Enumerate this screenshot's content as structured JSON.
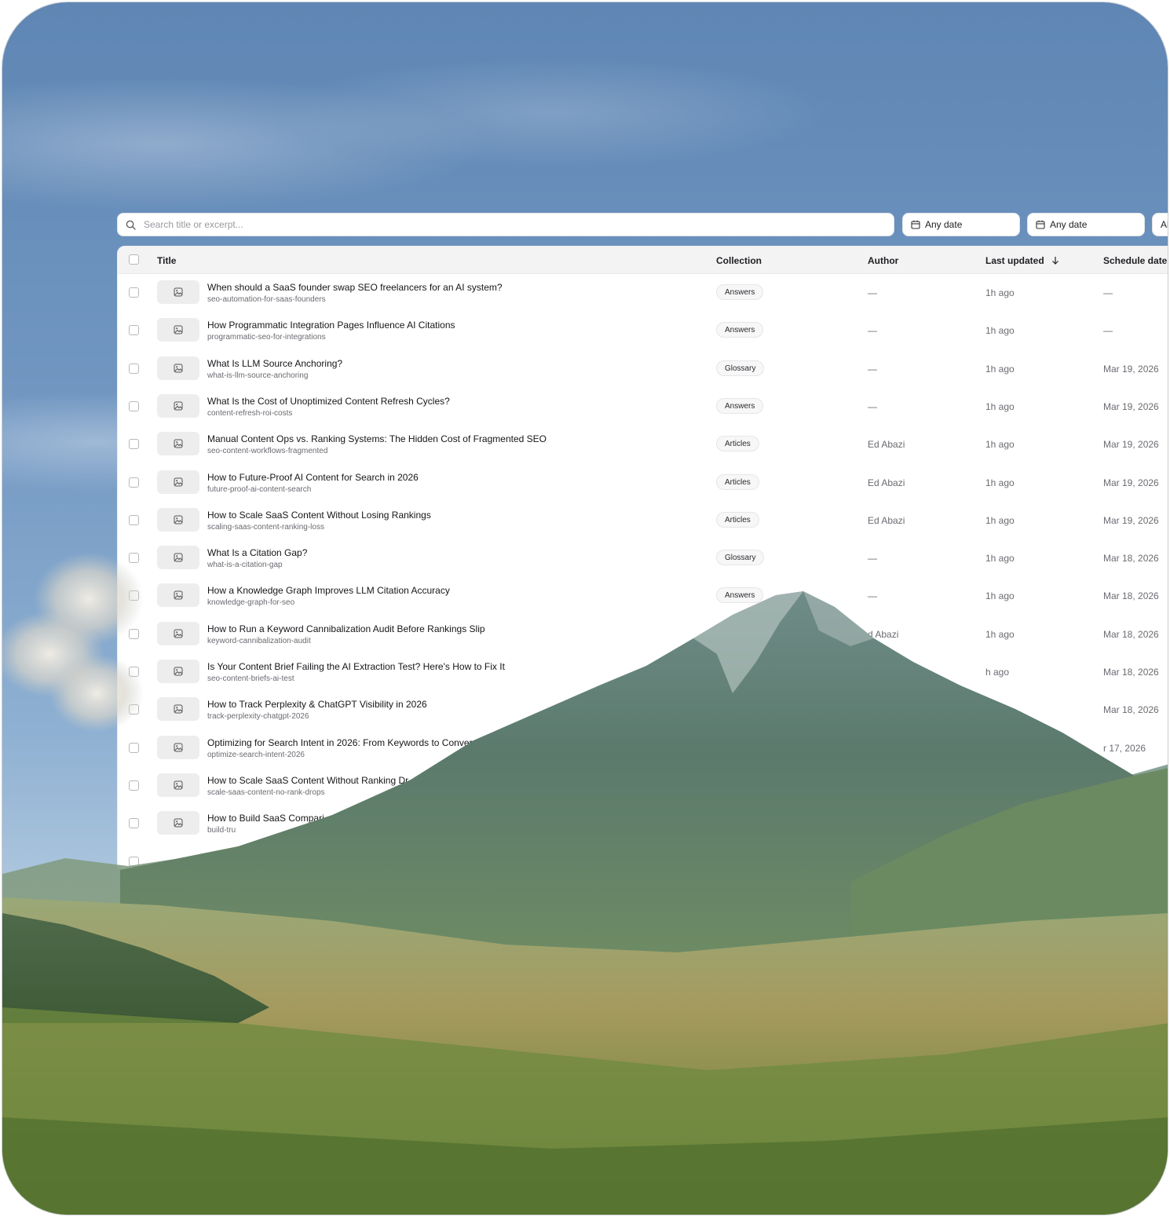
{
  "search": {
    "placeholder": "Search title or excerpt..."
  },
  "filters": {
    "date_from_label": "Any date",
    "date_to_label": "Any date",
    "third_label": "Al"
  },
  "table": {
    "columns": {
      "title": "Title",
      "collection": "Collection",
      "author": "Author",
      "last_updated": "Last updated",
      "schedule_date": "Schedule date"
    },
    "rows": [
      {
        "title": "When should a SaaS founder swap SEO freelancers for an AI system?",
        "slug": "seo-automation-for-saas-founders",
        "collection": "Answers",
        "author": "—",
        "updated": "1h ago",
        "schedule": "—"
      },
      {
        "title": "How Programmatic Integration Pages Influence AI Citations",
        "slug": "programmatic-seo-for-integrations",
        "collection": "Answers",
        "author": "—",
        "updated": "1h ago",
        "schedule": "—"
      },
      {
        "title": "What Is LLM Source Anchoring?",
        "slug": "what-is-llm-source-anchoring",
        "collection": "Glossary",
        "author": "—",
        "updated": "1h ago",
        "schedule": "Mar 19, 2026"
      },
      {
        "title": "What Is the Cost of Unoptimized Content Refresh Cycles?",
        "slug": "content-refresh-roi-costs",
        "collection": "Answers",
        "author": "—",
        "updated": "1h ago",
        "schedule": "Mar 19, 2026"
      },
      {
        "title": "Manual Content Ops vs. Ranking Systems: The Hidden Cost of Fragmented SEO",
        "slug": "seo-content-workflows-fragmented",
        "collection": "Articles",
        "author": "Ed Abazi",
        "updated": "1h ago",
        "schedule": "Mar 19, 2026"
      },
      {
        "title": "How to Future-Proof AI Content for Search in 2026",
        "slug": "future-proof-ai-content-search",
        "collection": "Articles",
        "author": "Ed Abazi",
        "updated": "1h ago",
        "schedule": "Mar 19, 2026"
      },
      {
        "title": "How to Scale SaaS Content Without Losing Rankings",
        "slug": "scaling-saas-content-ranking-loss",
        "collection": "Articles",
        "author": "Ed Abazi",
        "updated": "1h ago",
        "schedule": "Mar 19, 2026"
      },
      {
        "title": "What Is a Citation Gap?",
        "slug": "what-is-a-citation-gap",
        "collection": "Glossary",
        "author": "—",
        "updated": "1h ago",
        "schedule": "Mar 18, 2026"
      },
      {
        "title": "How a Knowledge Graph Improves LLM Citation Accuracy",
        "slug": "knowledge-graph-for-seo",
        "collection": "Answers",
        "author": "—",
        "updated": "1h ago",
        "schedule": "Mar 18, 2026"
      },
      {
        "title": "How to Run a Keyword Cannibalization Audit Before Rankings Slip",
        "slug": "keyword-cannibalization-audit",
        "collection": "",
        "author": "d Abazi",
        "updated": "1h ago",
        "schedule": "Mar 18, 2026"
      },
      {
        "title": "Is Your Content Brief Failing the AI Extraction Test? Here's How to Fix It",
        "slug": "seo-content-briefs-ai-test",
        "collection": "",
        "author": "",
        "updated": "h ago",
        "schedule": "Mar 18, 2026"
      },
      {
        "title": "How to Track Perplexity & ChatGPT Visibility in 2026",
        "slug": "track-perplexity-chatgpt-2026",
        "collection": "",
        "author": "",
        "updated": "",
        "schedule": "Mar 18, 2026"
      },
      {
        "title": "Optimizing for Search Intent in 2026: From Keywords to Conver",
        "slug": "optimize-search-intent-2026",
        "collection": "",
        "author": "",
        "updated": "",
        "schedule": "r 17, 2026"
      },
      {
        "title": "How to Scale SaaS Content Without Ranking Dr",
        "slug": "scale-saas-content-no-rank-drops",
        "collection": "",
        "author": "",
        "updated": "",
        "schedule": ""
      },
      {
        "title": "How to Build SaaS Compari",
        "slug": "build-tru",
        "collection": "",
        "author": "",
        "updated": "",
        "schedule": ""
      },
      {
        "title": "",
        "slug": "",
        "collection": "",
        "author": "",
        "updated": "",
        "schedule": ""
      }
    ]
  },
  "icons": {
    "search": "search-icon",
    "calendar": "calendar-icon",
    "sort": "arrow-down-icon",
    "thumbnail": "image-icon"
  },
  "colors": {
    "sky_top": "#5f86b4",
    "sky_bottom": "#d7e2ea",
    "mountain": "#5f7f6e",
    "grass": "#9a9a56"
  }
}
